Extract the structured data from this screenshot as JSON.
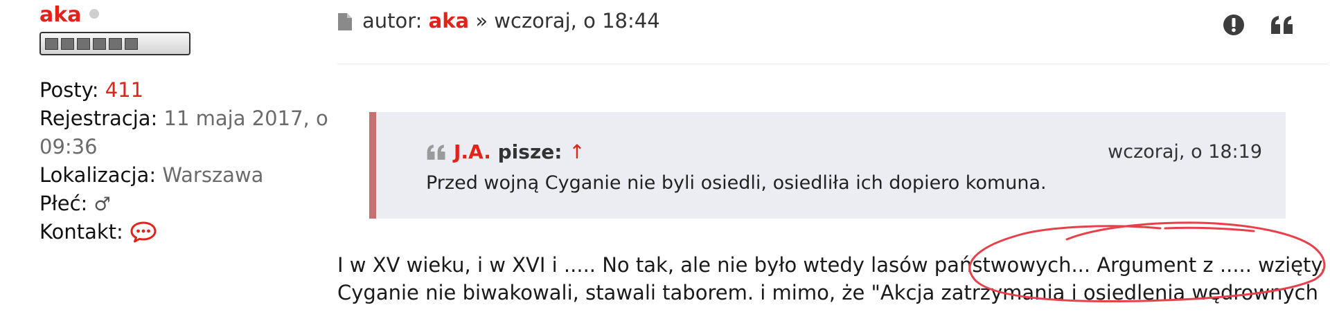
{
  "profile": {
    "username": "aka",
    "posts_label": "Posty:",
    "posts_value": "411",
    "registration_label": "Rejestracja:",
    "registration_value_line1": "11 maja 2017, o",
    "registration_value_line2": "09:36",
    "location_label": "Lokalizacja:",
    "location_value": "Warszawa",
    "gender_label": "Płeć:",
    "gender_value": "♂",
    "contact_label": "Kontakt:"
  },
  "post": {
    "author_prefix": "autor:",
    "author": "aka",
    "separator": "»",
    "time": "wczoraj, o 18:44"
  },
  "quote": {
    "author": "J.A.",
    "writes_label": "pisze:",
    "link_arrow": "↑",
    "time": "wczoraj, o 18:19",
    "text": "Przed wojną Cyganie nie byli osiedli, osiedliła ich dopiero komuna."
  },
  "body": {
    "line1": "I w XV wieku, i w XVI i ..... No tak, ale nie było wtedy lasów państwowych... Argument z ..... wzięty.",
    "line2": "Cyganie nie biwakowali, stawali taborem. i mimo, że \"Akcja zatrzymania i osiedlenia wędrownych"
  },
  "icons": {
    "online_status": "status-dot-icon",
    "post": "document-icon",
    "report": "exclamation-circle-icon",
    "quote": "quote-icon",
    "contact": "chat-bubble-icon"
  },
  "colors": {
    "accent": "#e2231a",
    "quote_border": "#c87070",
    "quote_background": "#ebedf2",
    "annotation": "#e8404a"
  }
}
